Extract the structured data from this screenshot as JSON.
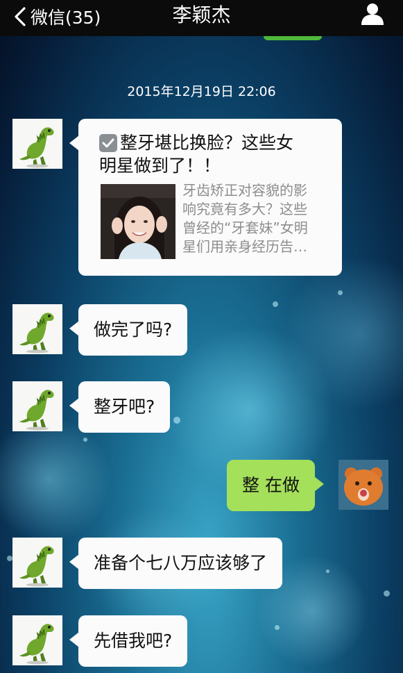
{
  "header": {
    "back_label": "微信(35)",
    "title": "李颖杰",
    "icons": {
      "back": "chevron-left-icon",
      "profile": "person-icon"
    }
  },
  "timestamp": "2015年12月19日 22:06",
  "article": {
    "title_line1": "整牙堪比换脸？这些女",
    "title_line2": "明星做到了！！",
    "desc": [
      "牙齿矫正对容貌的影",
      "响究竟有多大？这些",
      "曾经的“牙套妹”女明",
      "星们用亲身经历告…"
    ]
  },
  "messages": [
    {
      "side": "left",
      "text": "做完了吗?"
    },
    {
      "side": "left",
      "text": "整牙吧?"
    },
    {
      "side": "right",
      "text": "整 在做"
    },
    {
      "side": "left",
      "text": "准备个七八万应该够了"
    },
    {
      "side": "left",
      "text": "先借我吧?"
    }
  ],
  "colors": {
    "sent_bubble": "#a4e05a",
    "received_bubble": "#fbfbfb",
    "nav_bg": "#0b0b0b"
  }
}
